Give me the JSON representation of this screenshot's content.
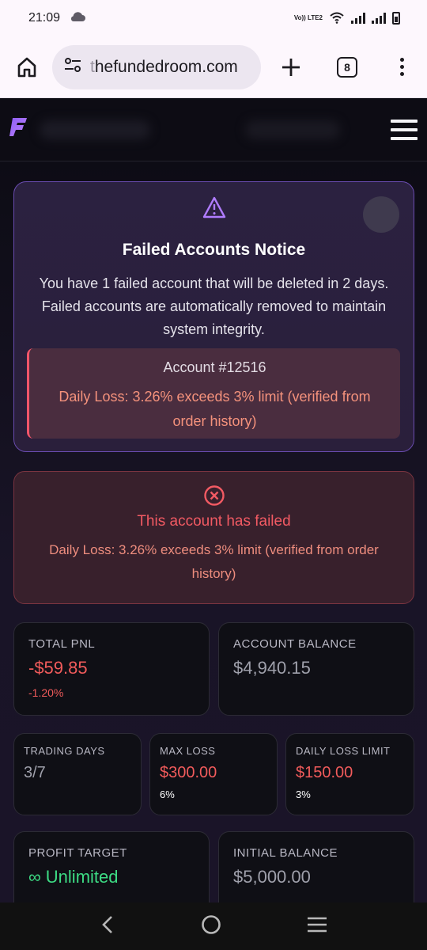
{
  "status_bar": {
    "time": "21:09",
    "network_label": "Vo)) LTE2",
    "icons": [
      "cloud-icon",
      "wifi-icon",
      "signal-icon",
      "signal-icon",
      "battery-icon"
    ]
  },
  "browser": {
    "url_prefix": "t",
    "url": "hefundedroom.com",
    "tab_count": "8"
  },
  "notice": {
    "title": "Failed Accounts Notice",
    "message": "You have 1 failed account that will be deleted in 2 days. Failed accounts are automatically removed to maintain system integrity.",
    "account_id": "Account #12516",
    "account_reason": "Daily Loss: 3.26% exceeds 3% limit (verified from order history)"
  },
  "failed_banner": {
    "title": "This account has failed",
    "reason": "Daily Loss: 3.26% exceeds 3% limit (verified from order history)"
  },
  "stats": {
    "total_pnl": {
      "label": "TOTAL PNL",
      "value": "-$59.85",
      "change": "-1.20%"
    },
    "account_balance": {
      "label": "ACCOUNT BALANCE",
      "value": "$4,940.15"
    },
    "trading_days": {
      "label": "TRADING DAYS",
      "value": "3/7"
    },
    "max_loss": {
      "label": "MAX LOSS",
      "value": "$300.00",
      "sub": "6%"
    },
    "daily_loss_limit": {
      "label": "DAILY LOSS LIMIT",
      "value": "$150.00",
      "sub": "3%"
    },
    "profit_target": {
      "label": "PROFIT TARGET",
      "value": "∞ Unlimited"
    },
    "initial_balance": {
      "label": "INITIAL BALANCE",
      "value": "$5,000.00"
    }
  },
  "colors": {
    "accent": "#a064ff",
    "danger": "#f15b5b",
    "success": "#3ddc84"
  }
}
